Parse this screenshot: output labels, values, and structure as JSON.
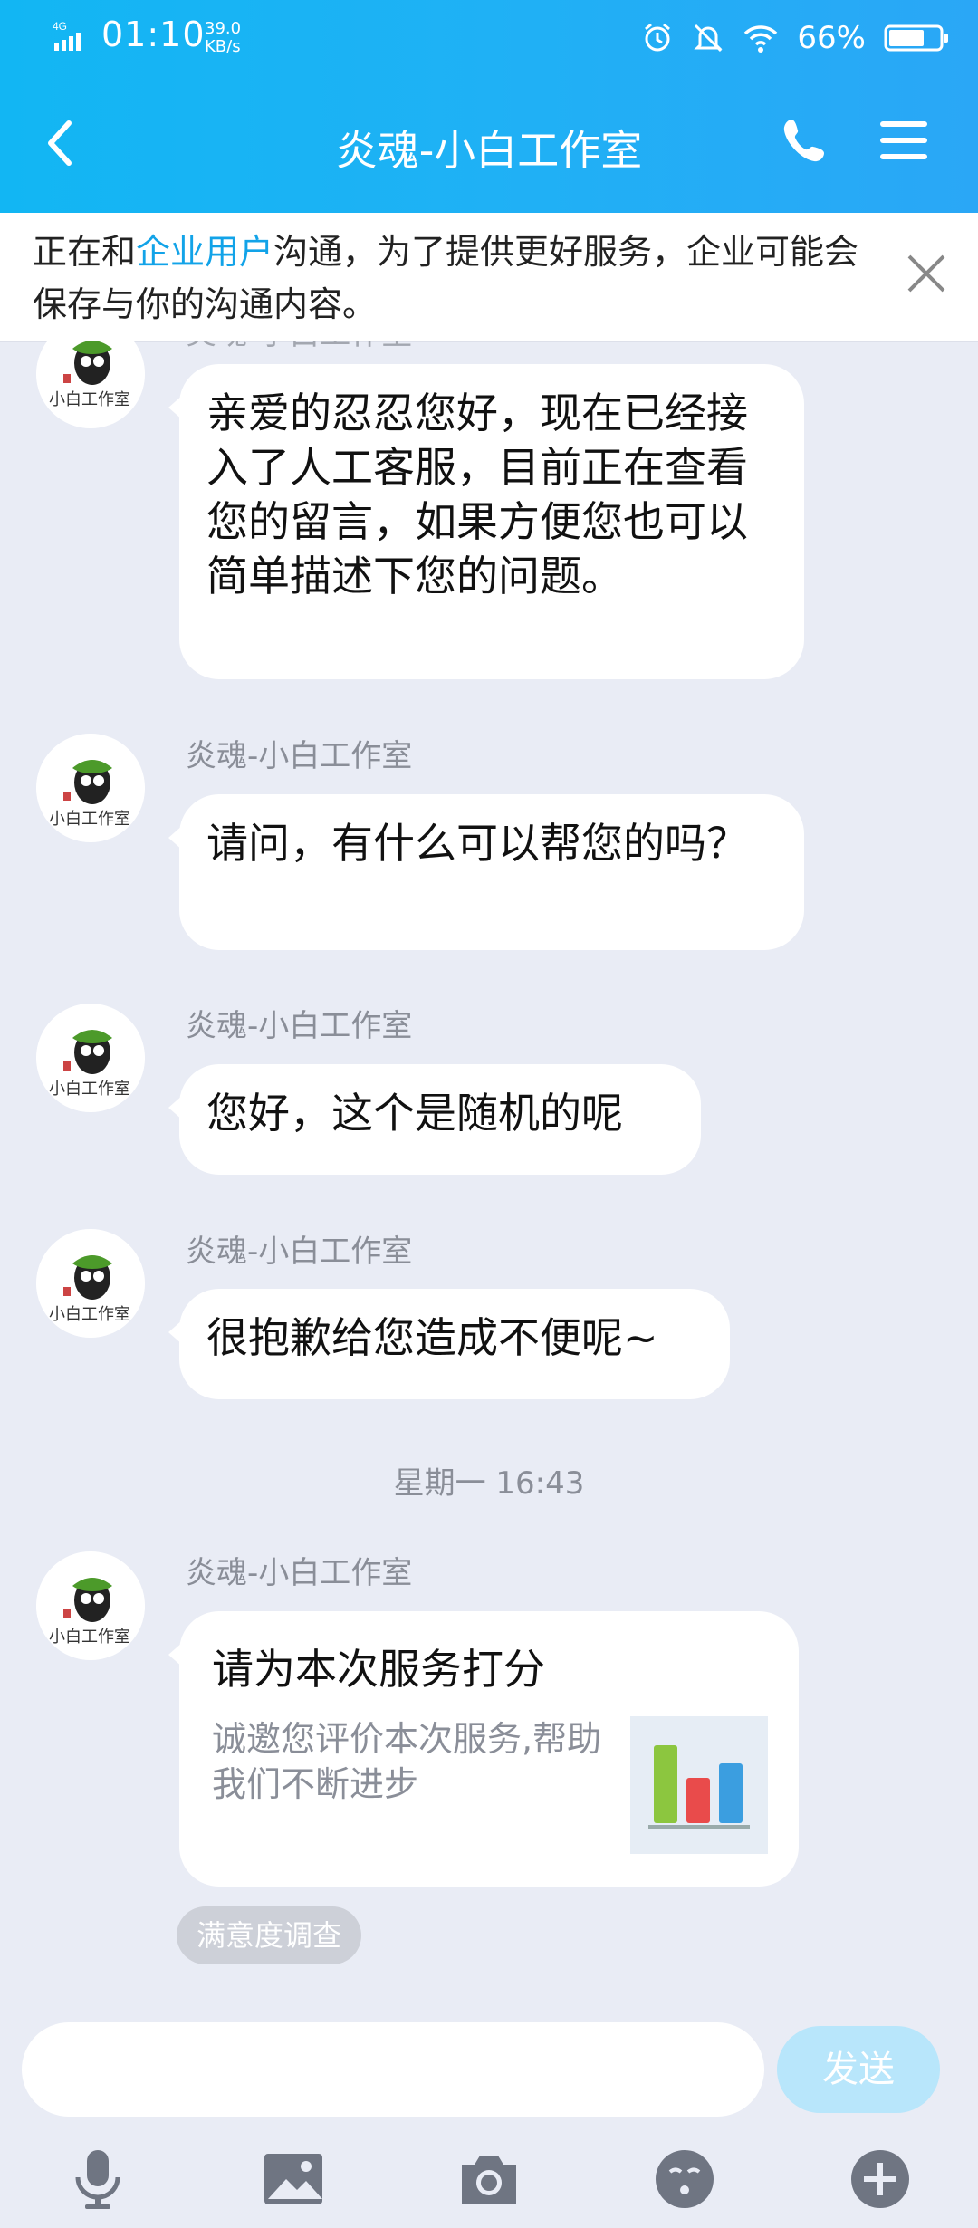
{
  "status_bar": {
    "network": "4G",
    "time": "01:10",
    "speed_value": "39.0",
    "speed_unit": "KB/s",
    "battery": "66%"
  },
  "header": {
    "title": "炎魂-小白工作室"
  },
  "notice": {
    "prefix": "正在和",
    "highlight": "企业用户",
    "suffix": "沟通，为了提供更好服务，企业可能会保存与你的沟通内容。"
  },
  "messages": [
    {
      "sender": "炎魂-小白工作室",
      "text": "亲爱的忍忍您好，现在已经接入了人工客服，目前正在查看您的留言，如果方便您也可以简单描述下您的问题。"
    },
    {
      "sender": "炎魂-小白工作室",
      "text": "请问，有什么可以帮您的吗？"
    },
    {
      "sender": "炎魂-小白工作室",
      "text": "您好，这个是随机的呢"
    },
    {
      "sender": "炎魂-小白工作室",
      "text": "很抱歉给您造成不便呢~"
    }
  ],
  "timestamp": "星期一 16:43",
  "card_message": {
    "sender": "炎魂-小白工作室",
    "title": "请为本次服务打分",
    "description": "诚邀您评价本次服务,帮助我们不断进步",
    "tag": "满意度调查"
  },
  "input": {
    "placeholder": "",
    "send_label": "发送"
  },
  "colors": {
    "header_gradient_start": "#12b6f3",
    "header_gradient_end": "#2aa7f6",
    "accent": "#12a3e8",
    "background": "#e9ecf5",
    "send_disabled": "#b8e6fb"
  },
  "toolbar": {
    "icons": [
      "microphone-icon",
      "image-icon",
      "camera-icon",
      "emoji-icon",
      "plus-icon"
    ]
  }
}
